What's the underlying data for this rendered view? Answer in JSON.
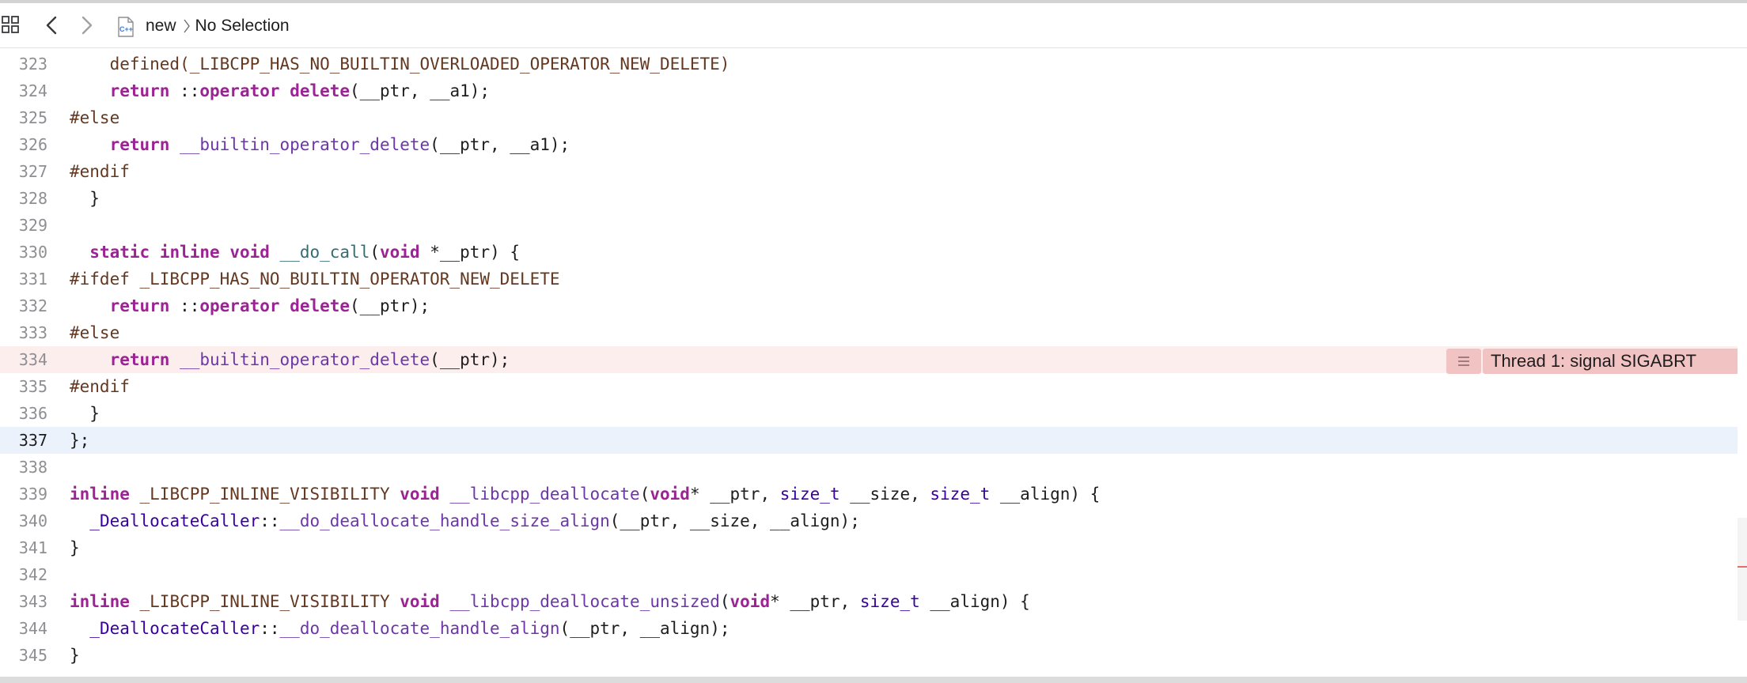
{
  "jumpbar": {
    "icons": [
      "grid-icon",
      "back-arrow-icon",
      "forward-arrow-icon",
      "cpp-file-icon"
    ],
    "crumb_file": "new",
    "crumb_symbol": "No Selection",
    "file_icon_label": "C++"
  },
  "editor": {
    "lines": [
      {
        "n": "323",
        "t": [
          [
            "pl",
            "    "
          ],
          [
            "pp",
            "defined(_LIBCPP_HAS_NO_BUILTIN_OVERLOADED_OPERATOR_NEW_DELETE)"
          ]
        ]
      },
      {
        "n": "324",
        "t": [
          [
            "pl",
            "    "
          ],
          [
            "kw",
            "return"
          ],
          [
            "pl",
            " ::"
          ],
          [
            "kw",
            "operator"
          ],
          [
            "pl",
            " "
          ],
          [
            "kw",
            "delete"
          ],
          [
            "pl",
            "(__ptr, __a1);"
          ]
        ]
      },
      {
        "n": "325",
        "t": [
          [
            "pp",
            "#else"
          ]
        ]
      },
      {
        "n": "326",
        "t": [
          [
            "pl",
            "    "
          ],
          [
            "kw",
            "return"
          ],
          [
            "pl",
            " "
          ],
          [
            "fn2",
            "__builtin_operator_delete"
          ],
          [
            "pl",
            "(__ptr, __a1);"
          ]
        ]
      },
      {
        "n": "327",
        "t": [
          [
            "pp",
            "#endif"
          ]
        ]
      },
      {
        "n": "328",
        "t": [
          [
            "pl",
            "  }"
          ]
        ]
      },
      {
        "n": "329",
        "t": []
      },
      {
        "n": "330",
        "t": [
          [
            "pl",
            "  "
          ],
          [
            "kw",
            "static"
          ],
          [
            "pl",
            " "
          ],
          [
            "kw",
            "inline"
          ],
          [
            "pl",
            " "
          ],
          [
            "kw",
            "void"
          ],
          [
            "pl",
            " "
          ],
          [
            "fn",
            "__do_call"
          ],
          [
            "pl",
            "("
          ],
          [
            "kw",
            "void"
          ],
          [
            "pl",
            " *__ptr) {"
          ]
        ]
      },
      {
        "n": "331",
        "t": [
          [
            "pp",
            "#ifdef _LIBCPP_HAS_NO_BUILTIN_OPERATOR_NEW_DELETE"
          ]
        ]
      },
      {
        "n": "332",
        "t": [
          [
            "pl",
            "    "
          ],
          [
            "kw",
            "return"
          ],
          [
            "pl",
            " ::"
          ],
          [
            "kw",
            "operator"
          ],
          [
            "pl",
            " "
          ],
          [
            "kw",
            "delete"
          ],
          [
            "pl",
            "(__ptr);"
          ]
        ]
      },
      {
        "n": "333",
        "t": [
          [
            "pp",
            "#else"
          ]
        ]
      },
      {
        "n": "334",
        "t": [
          [
            "pl",
            "    "
          ],
          [
            "kw",
            "return"
          ],
          [
            "pl",
            " "
          ],
          [
            "fn2",
            "__builtin_operator_delete"
          ],
          [
            "pl",
            "(__ptr);"
          ]
        ],
        "state": "error"
      },
      {
        "n": "335",
        "t": [
          [
            "pp",
            "#endif"
          ]
        ]
      },
      {
        "n": "336",
        "t": [
          [
            "pl",
            "  }"
          ]
        ]
      },
      {
        "n": "337",
        "t": [
          [
            "pl",
            "};"
          ]
        ],
        "state": "current"
      },
      {
        "n": "338",
        "t": []
      },
      {
        "n": "339",
        "t": [
          [
            "kw",
            "inline"
          ],
          [
            "pl",
            " "
          ],
          [
            "pp",
            "_LIBCPP_INLINE_VISIBILITY"
          ],
          [
            "pl",
            " "
          ],
          [
            "kw",
            "void"
          ],
          [
            "pl",
            " "
          ],
          [
            "fn2",
            "__libcpp_deallocate"
          ],
          [
            "pl",
            "("
          ],
          [
            "kw",
            "void"
          ],
          [
            "pl",
            "* __ptr, "
          ],
          [
            "ty",
            "size_t"
          ],
          [
            "pl",
            " __size, "
          ],
          [
            "ty",
            "size_t"
          ],
          [
            "pl",
            " __align) {"
          ]
        ]
      },
      {
        "n": "340",
        "t": [
          [
            "pl",
            "  "
          ],
          [
            "ty",
            "_DeallocateCaller"
          ],
          [
            "pl",
            "::"
          ],
          [
            "fn2",
            "__do_deallocate_handle_size_align"
          ],
          [
            "pl",
            "(__ptr, __size, __align);"
          ]
        ]
      },
      {
        "n": "341",
        "t": [
          [
            "pl",
            "}"
          ]
        ]
      },
      {
        "n": "342",
        "t": []
      },
      {
        "n": "343",
        "t": [
          [
            "kw",
            "inline"
          ],
          [
            "pl",
            " "
          ],
          [
            "pp",
            "_LIBCPP_INLINE_VISIBILITY"
          ],
          [
            "pl",
            " "
          ],
          [
            "kw",
            "void"
          ],
          [
            "pl",
            " "
          ],
          [
            "fn2",
            "__libcpp_deallocate_unsized"
          ],
          [
            "pl",
            "("
          ],
          [
            "kw",
            "void"
          ],
          [
            "pl",
            "* __ptr, "
          ],
          [
            "ty",
            "size_t"
          ],
          [
            "pl",
            " __align) {"
          ]
        ]
      },
      {
        "n": "344",
        "t": [
          [
            "pl",
            "  "
          ],
          [
            "ty",
            "_DeallocateCaller"
          ],
          [
            "pl",
            "::"
          ],
          [
            "fn2",
            "__do_deallocate_handle_align"
          ],
          [
            "pl",
            "(__ptr, __align);"
          ]
        ]
      },
      {
        "n": "345",
        "t": [
          [
            "pl",
            "}"
          ]
        ]
      }
    ],
    "error_annotation": {
      "line": "334",
      "message": "Thread 1: signal SIGABRT",
      "icon": "lines-icon"
    }
  },
  "colors": {
    "keyword": "#9b2393",
    "preprocessor": "#643820",
    "function_decl": "#326d74",
    "function_call": "#6c36a9",
    "type": "#3900a0",
    "error_line_bg": "#fdeeee",
    "error_badge_bg": "#f2c3c3",
    "current_line_bg": "#ecf2fb"
  }
}
